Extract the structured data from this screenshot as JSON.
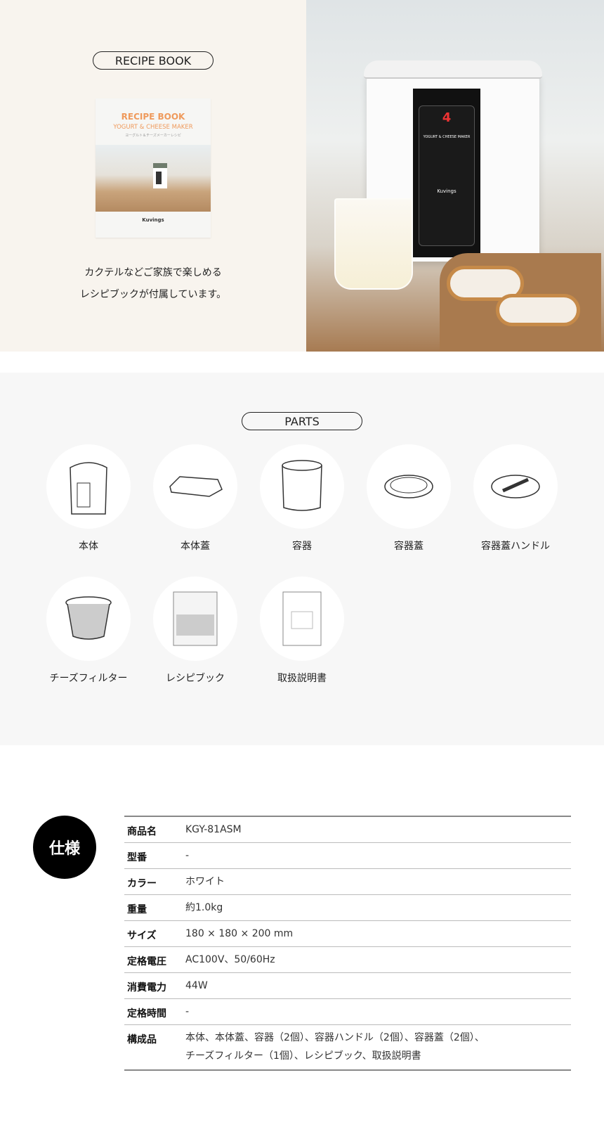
{
  "recipe": {
    "badge": "RECIPE BOOK",
    "book": {
      "title": "RECIPE BOOK",
      "subtitle": "YOGURT & CHEESE MAKER",
      "jp_subtitle": "ヨーグルト＆チーズメーカーレシピ",
      "logo": "Kuvings"
    },
    "caption_line1": "カクテルなどご家族で楽しめる",
    "caption_line2": "レシピブックが付属しています。"
  },
  "photo": {
    "panel_title": "YOGURT & CHEESE MAKER",
    "brand": "Kuvings",
    "display_digit": "4"
  },
  "parts": {
    "badge": "PARTS",
    "items": [
      {
        "label": "本体",
        "icon": "main-body-icon"
      },
      {
        "label": "本体蓋",
        "icon": "body-lid-icon"
      },
      {
        "label": "容器",
        "icon": "container-icon"
      },
      {
        "label": "容器蓋",
        "icon": "container-lid-icon"
      },
      {
        "label": "容器蓋ハンドル",
        "icon": "container-lid-handle-icon"
      },
      {
        "label": "チーズフィルター",
        "icon": "cheese-filter-icon"
      },
      {
        "label": "レシピブック",
        "icon": "recipe-book-icon"
      },
      {
        "label": "取扱説明書",
        "icon": "manual-icon"
      }
    ]
  },
  "specs": {
    "badge": "仕様",
    "rows": [
      {
        "key": "商品名",
        "value": "KGY-81ASM"
      },
      {
        "key": "型番",
        "value": "-"
      },
      {
        "key": "カラー",
        "value": "ホワイト"
      },
      {
        "key": "重量",
        "value": "約1.0kg"
      },
      {
        "key": "サイズ",
        "value": "180 × 180 × 200 mm"
      },
      {
        "key": "定格電圧",
        "value": "AC100V、50/60Hz"
      },
      {
        "key": "消費電力",
        "value": "44W"
      },
      {
        "key": "定格時間",
        "value": "-"
      },
      {
        "key": "構成品",
        "value": "本体、本体蓋、容器（2個）、容器ハンドル（2個）、容器蓋（2個）、",
        "value2": "チーズフィルター（1個）、レシピブック、取扱説明書"
      }
    ]
  }
}
